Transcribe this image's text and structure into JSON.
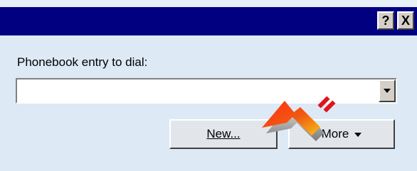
{
  "titlebar": {
    "help_label": "?",
    "close_label": "X"
  },
  "dialog": {
    "prompt_label": "Phonebook entry to dial:",
    "entry_value": "",
    "buttons": {
      "new_label": "New...",
      "more_label": "More"
    }
  },
  "icons": {
    "help": "question-mark-icon",
    "close": "close-icon",
    "dropdown": "chevron-down-icon",
    "pointer": "arrow-pointer-icon"
  },
  "colors": {
    "titlebar": "#000080",
    "client_bg": "#dde9f5",
    "button_face": "#d4d0c8",
    "arrow_red": "#e0141a",
    "arrow_yellow": "#f7c21a"
  }
}
